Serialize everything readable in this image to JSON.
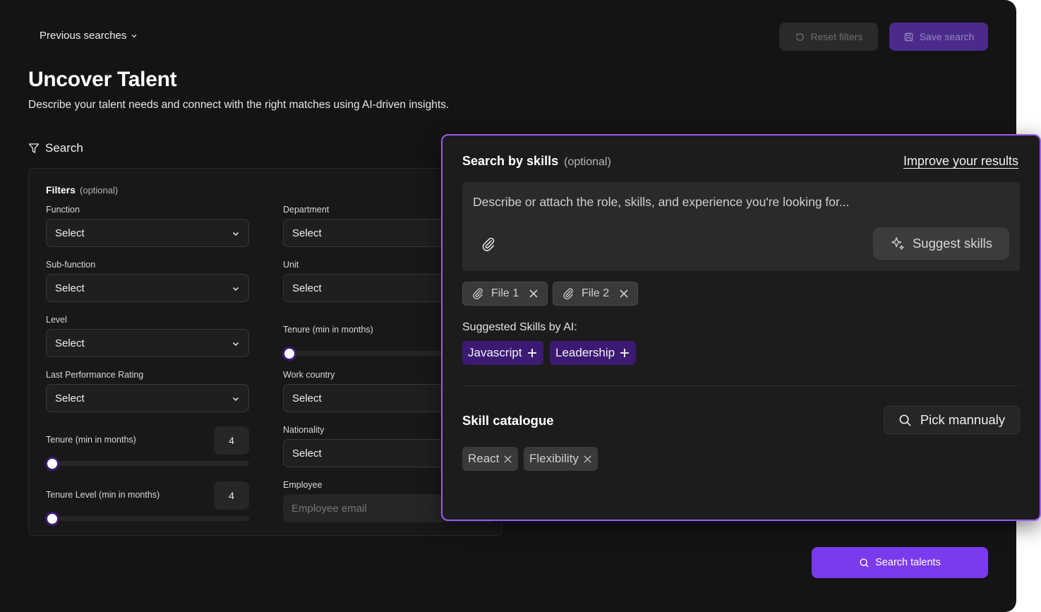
{
  "header": {
    "previous_searches": "Previous searches",
    "reset_filters": "Reset filters",
    "save_search": "Save search"
  },
  "page": {
    "title": "Uncover Talent",
    "subtitle": "Describe your talent needs and connect with the right matches using AI-driven insights.",
    "search_label": "Search"
  },
  "filters": {
    "title": "Filters",
    "optional": "(optional)",
    "function": {
      "label": "Function",
      "value": "Select"
    },
    "department": {
      "label": "Department",
      "value": "Select"
    },
    "sub_function": {
      "label": "Sub-function",
      "value": "Select"
    },
    "unit": {
      "label": "Unit",
      "value": "Select"
    },
    "level": {
      "label": "Level",
      "value": "Select"
    },
    "tenure_right": {
      "label": "Tenure (min in months)"
    },
    "last_performance": {
      "label": "Last Performance Rating",
      "value": "Select"
    },
    "work_country": {
      "label": "Work country",
      "value": "Select"
    },
    "tenure": {
      "label": "Tenure (min in months)",
      "value": "4"
    },
    "nationality": {
      "label": "Nationality",
      "value": "Select"
    },
    "tenure_level": {
      "label": "Tenure Level (min in months)",
      "value": "4"
    },
    "employee": {
      "label": "Employee",
      "placeholder": "Employee email"
    }
  },
  "search_button": "Search talents",
  "skills_panel": {
    "title": "Search by skills",
    "optional": "(optional)",
    "improve_link": "Improve your results",
    "placeholder": "Describe or attach the role, skills, and experience you're looking for...",
    "suggest_button": "Suggest skills",
    "files": [
      "File 1",
      "File 2"
    ],
    "suggested_label": "Suggested Skills by AI:",
    "suggested_skills": [
      "Javascript",
      "Leadership"
    ],
    "catalogue_title": "Skill catalogue",
    "pick_button": "Pick mannualy",
    "catalogue_skills": [
      "React",
      "Flexibility"
    ]
  },
  "colors": {
    "accent": "#7c3aed",
    "panel_border": "#9b5cf0",
    "chip_ai": "#3b1a73"
  }
}
